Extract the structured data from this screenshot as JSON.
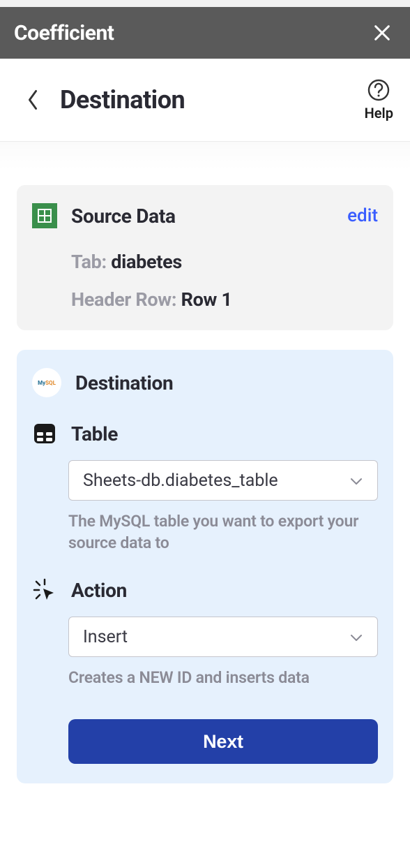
{
  "titlebar": {
    "title": "Coefficient"
  },
  "header": {
    "page_title": "Destination",
    "help_label": "Help"
  },
  "source_card": {
    "title": "Source Data",
    "edit_label": "edit",
    "tab_label": "Tab:",
    "tab_value": "diabetes",
    "header_row_label": "Header Row:",
    "header_row_value": "Row 1"
  },
  "dest_card": {
    "title": "Destination",
    "table_section_title": "Table",
    "table_select_value": "Sheets-db.diabetes_table",
    "table_helper": "The MySQL table you want to export your source data to",
    "action_section_title": "Action",
    "action_select_value": "Insert",
    "action_helper": "Creates a NEW ID and inserts data",
    "next_button_label": "Next"
  }
}
